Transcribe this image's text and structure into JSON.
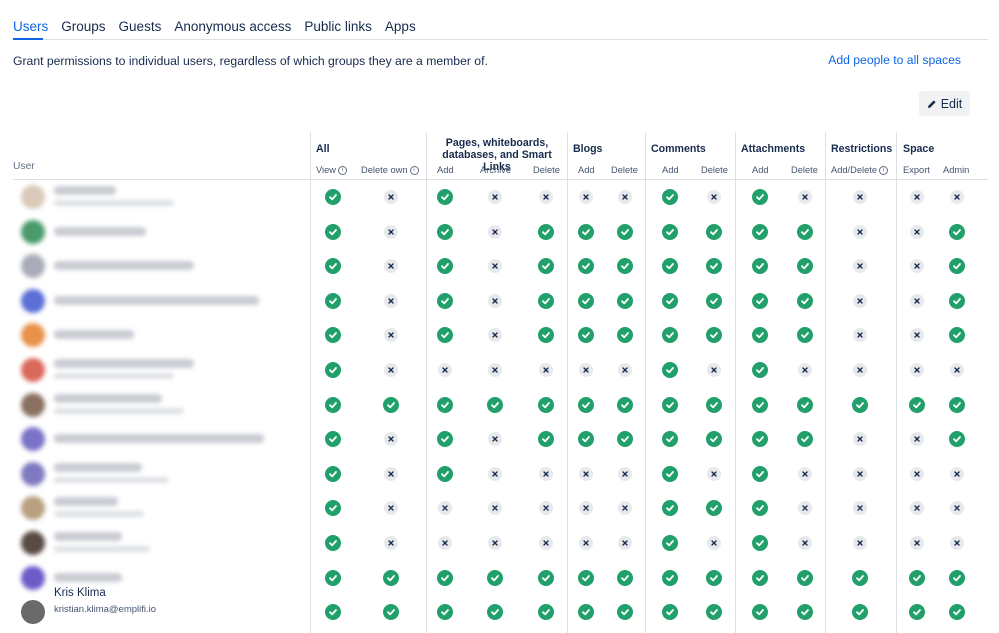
{
  "tabs": [
    "Users",
    "Groups",
    "Guests",
    "Anonymous access",
    "Public links",
    "Apps"
  ],
  "description": "Grant permissions to individual users, regardless of which groups they are a member of.",
  "add_link": "Add people to all spaces",
  "edit_label": "Edit",
  "user_header": "User",
  "groups": [
    {
      "title": "All"
    },
    {
      "title": "Pages, whiteboards,\ndatabases, and Smart Links"
    },
    {
      "title": "Blogs"
    },
    {
      "title": "Comments"
    },
    {
      "title": "Attachments"
    },
    {
      "title": "Restrictions"
    },
    {
      "title": "Space"
    }
  ],
  "subheaders": [
    "View",
    "Delete own",
    "Add",
    "Archive",
    "Delete",
    "Add",
    "Delete",
    "Add",
    "Delete",
    "Add",
    "Delete",
    "Add/Delete",
    "Export",
    "Admin"
  ],
  "colors": {
    "accent": "#0c66e4",
    "yes": "#22a06b",
    "no": "#e7e9ec"
  },
  "users": [
    {
      "avatar_color": "#d9c9b8",
      "permissions": [
        1,
        0,
        1,
        0,
        0,
        0,
        0,
        1,
        0,
        1,
        0,
        0,
        0,
        0
      ]
    },
    {
      "avatar_color": "#4a9a6a",
      "permissions": [
        1,
        0,
        1,
        0,
        1,
        1,
        1,
        1,
        1,
        1,
        1,
        0,
        0,
        1
      ]
    },
    {
      "avatar_color": "#a9abb8",
      "permissions": [
        1,
        0,
        1,
        0,
        1,
        1,
        1,
        1,
        1,
        1,
        1,
        0,
        0,
        1
      ]
    },
    {
      "avatar_color": "#5b6fd6",
      "permissions": [
        1,
        0,
        1,
        0,
        1,
        1,
        1,
        1,
        1,
        1,
        1,
        0,
        0,
        1
      ]
    },
    {
      "avatar_color": "#e8914a",
      "permissions": [
        1,
        0,
        1,
        0,
        1,
        1,
        1,
        1,
        1,
        1,
        1,
        0,
        0,
        1
      ]
    },
    {
      "avatar_color": "#d9695a",
      "permissions": [
        1,
        0,
        0,
        0,
        0,
        0,
        0,
        1,
        0,
        1,
        0,
        0,
        0,
        0
      ]
    },
    {
      "avatar_color": "#8a7060",
      "permissions": [
        1,
        1,
        1,
        1,
        1,
        1,
        1,
        1,
        1,
        1,
        1,
        1,
        1,
        1
      ]
    },
    {
      "avatar_color": "#7a72c8",
      "permissions": [
        1,
        0,
        1,
        0,
        1,
        1,
        1,
        1,
        1,
        1,
        1,
        0,
        0,
        1
      ]
    },
    {
      "avatar_color": "#7f7ac0",
      "permissions": [
        1,
        0,
        1,
        0,
        0,
        0,
        0,
        1,
        0,
        1,
        0,
        0,
        0,
        0
      ]
    },
    {
      "avatar_color": "#b8a080",
      "permissions": [
        1,
        0,
        0,
        0,
        0,
        0,
        0,
        1,
        1,
        1,
        0,
        0,
        0,
        0
      ]
    },
    {
      "avatar_color": "#5a4a44",
      "permissions": [
        1,
        0,
        0,
        0,
        0,
        0,
        0,
        1,
        0,
        1,
        0,
        0,
        0,
        0
      ]
    },
    {
      "avatar_color": "#6b5cc8",
      "permissions": [
        1,
        1,
        1,
        1,
        1,
        1,
        1,
        1,
        1,
        1,
        1,
        1,
        1,
        1
      ]
    },
    {
      "avatar_color": "#6a6a6a",
      "name": "Kris Klima",
      "email": "kristian.klima@emplifi.io",
      "permissions": [
        1,
        1,
        1,
        1,
        1,
        1,
        1,
        1,
        1,
        1,
        1,
        1,
        1,
        1
      ]
    }
  ]
}
